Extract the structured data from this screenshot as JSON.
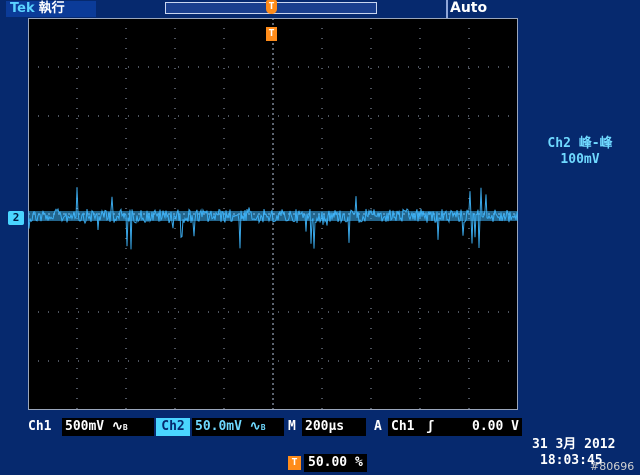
{
  "brand": {
    "logo": "Tek",
    "run_state": "執行"
  },
  "trigger_mode": "Auto",
  "channel_marker": "2",
  "trigger_marker": "T",
  "measurement": {
    "label": "Ch2 峰-峰",
    "value": "100mV"
  },
  "status": {
    "ch1_label": "Ch1",
    "ch1_scale": "500mV",
    "ch1_coupling_icon": "ac-coupling-icon",
    "ch2_label": "Ch2",
    "ch2_scale": "50.0mV",
    "ch2_coupling_icon": "ac-coupling-icon",
    "timebase_label": "M",
    "timebase": "200µs",
    "trigger_label": "A",
    "trigger_source": "Ch1",
    "trigger_slope_icon": "rising-edge-icon",
    "trigger_level": "0.00 V",
    "horizontal_position": "50.00 %"
  },
  "date": "31 3月  2012",
  "time": "18:03:45",
  "watermark": "#80696",
  "colors": {
    "screen_bg": "#06296e",
    "graticule_bg": "#000000",
    "grid_dots": "#9aa6bb",
    "ch2_trace": "#3fb8ff",
    "trigger_marker": "#ff8c1a"
  },
  "waveform": {
    "description_level": "Ch2 noise",
    "peak_to_peak_mV": 100
  }
}
